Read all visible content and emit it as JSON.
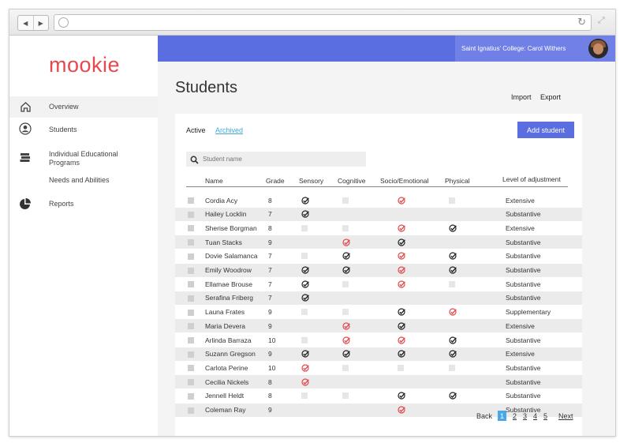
{
  "sidebar": {
    "logo": "mookie",
    "items": [
      {
        "label": "Overview",
        "icon": "home-icon"
      },
      {
        "label": "Students",
        "icon": "user-icon"
      },
      {
        "label": "Individual Educational Programs",
        "icon": "books-icon"
      },
      {
        "label": "Needs and Abilities",
        "icon": ""
      },
      {
        "label": "Reports",
        "icon": "pie-chart-icon"
      }
    ]
  },
  "header": {
    "user_text": "Saint Ignatius' College: Carol Withers"
  },
  "page": {
    "title": "Students",
    "import_label": "Import",
    "export_label": "Export"
  },
  "tabs": {
    "active": "Active",
    "archived": "Archived"
  },
  "add_student_label": "Add student",
  "search": {
    "placeholder": "Student name"
  },
  "columns": {
    "name": "Name",
    "grade": "Grade",
    "sensory": "Sensory",
    "cognitive": "Cognitive",
    "socio": "Socio/Emotional",
    "physical": "Physical",
    "level": "Level of adjustment"
  },
  "colors": {
    "accent": "#5b6ee1",
    "logo": "#e5484d",
    "check_red": "#e5484d",
    "check_dark": "#222222",
    "page_active": "#4aa8e8"
  },
  "students": [
    {
      "name": "Cordia Acy",
      "grade": "8",
      "sensory": "dark",
      "cognitive": "empty",
      "socio": "red",
      "physical": "empty",
      "level": "Extensive"
    },
    {
      "name": "Hailey Locklin",
      "grade": "7",
      "sensory": "dark",
      "cognitive": "",
      "socio": "",
      "physical": "",
      "level": "Substantive"
    },
    {
      "name": "Sherise Borgman",
      "grade": "8",
      "sensory": "empty",
      "cognitive": "empty",
      "socio": "red",
      "physical": "dark",
      "level": "Extensive"
    },
    {
      "name": "Tuan Stacks",
      "grade": "9",
      "sensory": "",
      "cognitive": "red",
      "socio": "dark",
      "physical": "",
      "level": "Substantive"
    },
    {
      "name": "Dovie Salamanca",
      "grade": "7",
      "sensory": "empty",
      "cognitive": "dark",
      "socio": "red",
      "physical": "dark",
      "level": "Substantive"
    },
    {
      "name": "Emily Woodrow",
      "grade": "7",
      "sensory": "dark",
      "cognitive": "dark",
      "socio": "red",
      "physical": "dark",
      "level": "Substantive"
    },
    {
      "name": "Ellamae Brouse",
      "grade": "7",
      "sensory": "dark",
      "cognitive": "empty",
      "socio": "red",
      "physical": "empty",
      "level": "Substantive"
    },
    {
      "name": "Serafina Friberg",
      "grade": "7",
      "sensory": "dark",
      "cognitive": "",
      "socio": "",
      "physical": "",
      "level": "Substantive"
    },
    {
      "name": "Launa Frates",
      "grade": "9",
      "sensory": "empty",
      "cognitive": "empty",
      "socio": "dark",
      "physical": "red",
      "level": "Supplementary"
    },
    {
      "name": "Maria Devera",
      "grade": "9",
      "sensory": "",
      "cognitive": "red",
      "socio": "dark",
      "physical": "",
      "level": "Extensive"
    },
    {
      "name": "Arlinda Barraza",
      "grade": "10",
      "sensory": "empty",
      "cognitive": "red",
      "socio": "red",
      "physical": "dark",
      "level": "Substantive"
    },
    {
      "name": "Suzann Gregson",
      "grade": "9",
      "sensory": "dark",
      "cognitive": "dark",
      "socio": "dark",
      "physical": "dark",
      "level": "Extensive"
    },
    {
      "name": "Carlota Perine",
      "grade": "10",
      "sensory": "red",
      "cognitive": "empty",
      "socio": "empty",
      "physical": "empty",
      "level": "Substantive"
    },
    {
      "name": "Cecilia Nickels",
      "grade": "8",
      "sensory": "red",
      "cognitive": "",
      "socio": "",
      "physical": "",
      "level": "Substantive"
    },
    {
      "name": "Jennell Heldt",
      "grade": "8",
      "sensory": "empty",
      "cognitive": "empty",
      "socio": "dark",
      "physical": "dark",
      "level": "Substantive"
    },
    {
      "name": "Coleman Ray",
      "grade": "9",
      "sensory": "",
      "cognitive": "",
      "socio": "red",
      "physical": "",
      "level": "Substantive"
    }
  ],
  "pagination": {
    "back": "Back",
    "current": "1",
    "pages": [
      "2",
      "3",
      "4",
      "5"
    ],
    "next": "Next"
  }
}
